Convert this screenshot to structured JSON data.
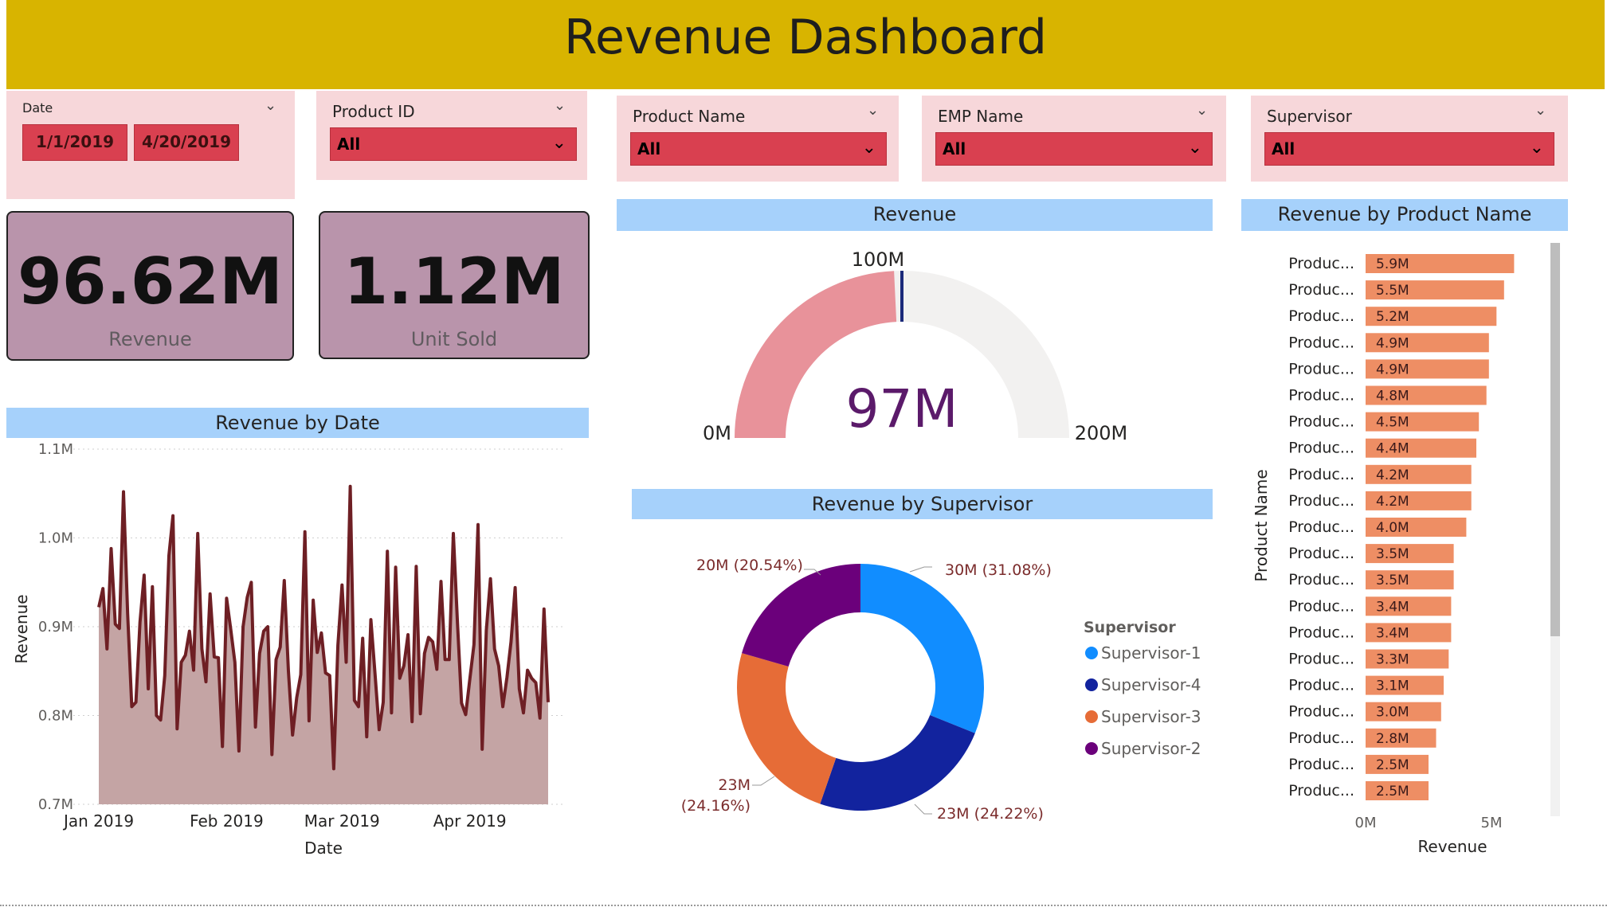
{
  "header": {
    "title": "Revenue Dashboard"
  },
  "filters": {
    "date": {
      "label": "Date",
      "start": "1/1/2019",
      "end": "4/20/2019"
    },
    "product_id": {
      "label": "Product ID",
      "value": "All"
    },
    "product_name": {
      "label": "Product Name",
      "value": "All"
    },
    "emp_name": {
      "label": "EMP Name",
      "value": "All"
    },
    "supervisor": {
      "label": "Supervisor",
      "value": "All"
    }
  },
  "kpis": {
    "revenue": {
      "value": "96.62M",
      "label": "Revenue"
    },
    "units": {
      "value": "1.12M",
      "label": "Unit Sold"
    }
  },
  "colors": {
    "banner": "#d8b400",
    "slicer_bg": "#f7d7da",
    "dropdown": "#d94050",
    "kpi_bg": "#b994ab",
    "title_bar": "#a6d1fb",
    "line": "#6e1f24",
    "area": "#c4a4a4",
    "bars": "#ee8e64",
    "gauge_fill": "#e8929a",
    "gauge_track": "#f2f1f0",
    "gauge_target": "#1b2a7a"
  },
  "chart_data": [
    {
      "type": "area",
      "title": "Revenue by Date",
      "xlabel": "Date",
      "ylabel": "Revenue",
      "ylim": [
        700000,
        1100000
      ],
      "yticks": [
        "0.7M",
        "0.8M",
        "0.9M",
        "1.0M",
        "1.1M"
      ],
      "yticks_values": [
        700000,
        800000,
        900000,
        1000000,
        1100000
      ],
      "xticks": [
        "Jan 2019",
        "Feb 2019",
        "Mar 2019",
        "Apr 2019"
      ],
      "xticks_days": [
        0,
        31,
        59,
        90
      ],
      "x_start": "2019-01-01",
      "series": [
        {
          "values": [
            922000,
            943000,
            875000,
            988000,
            903000,
            898000,
            1052000,
            915000,
            810000,
            815000,
            905000,
            958000,
            830000,
            945000,
            800000,
            795000,
            845000,
            980000,
            1025000,
            785000,
            860000,
            868000,
            895000,
            851000,
            1005000,
            875000,
            838000,
            937000,
            866000,
            865000,
            765000,
            932000,
            897000,
            860000,
            760000,
            900000,
            933000,
            950000,
            787000,
            870000,
            895000,
            900000,
            756000,
            863000,
            877000,
            952000,
            850000,
            778000,
            820000,
            846000,
            1007000,
            794000,
            930000,
            871000,
            893000,
            848000,
            845000,
            740000,
            879000,
            947000,
            860000,
            1058000,
            817000,
            810000,
            887000,
            776000,
            908000,
            847000,
            784000,
            815000,
            985000,
            803000,
            967000,
            842000,
            856000,
            891000,
            793000,
            968000,
            802000,
            870000,
            888000,
            883000,
            852000,
            951000,
            863000,
            863000,
            1005000,
            904000,
            814000,
            801000,
            841000,
            880000,
            1015000,
            762000,
            896000,
            954000,
            875000,
            856000,
            810000,
            843000,
            883000,
            944000,
            830000,
            803000,
            851000,
            842000,
            837000,
            797000,
            920000,
            815000
          ]
        }
      ]
    },
    {
      "type": "gauge",
      "title": "Revenue",
      "value": 97,
      "value_label": "97M",
      "min_label": "0M",
      "max_label": "200M",
      "target_label": "100M",
      "min": 0,
      "max": 200,
      "target": 100
    },
    {
      "type": "pie",
      "title": "Revenue by Supervisor",
      "legend_title": "Supervisor",
      "legend": [
        "Supervisor-1",
        "Supervisor-4",
        "Supervisor-3",
        "Supervisor-2"
      ],
      "slices": [
        {
          "name": "Supervisor-1",
          "value": 31.08,
          "label": "30M (31.08%)",
          "color": "#118dff"
        },
        {
          "name": "Supervisor-4",
          "value": 24.22,
          "label": "23M (24.22%)",
          "color": "#12239e"
        },
        {
          "name": "Supervisor-3",
          "value": 24.16,
          "label_line1": "23M",
          "label_line2": "(24.16%)",
          "color": "#e66c37"
        },
        {
          "name": "Supervisor-2",
          "value": 20.54,
          "label": "20M (20.54%)",
          "color": "#6b007b"
        }
      ]
    },
    {
      "type": "bar",
      "orientation": "horizontal",
      "title": "Revenue by Product Name",
      "xlabel": "Revenue",
      "ylabel": "Product Name",
      "xticks": [
        "0M",
        "5M"
      ],
      "categories": [
        "Produc...",
        "Produc...",
        "Produc...",
        "Produc...",
        "Produc...",
        "Produc...",
        "Produc...",
        "Produc...",
        "Produc...",
        "Produc...",
        "Produc...",
        "Produc...",
        "Produc...",
        "Produc...",
        "Produc...",
        "Produc...",
        "Produc...",
        "Produc...",
        "Produc...",
        "Produc...",
        "Produc..."
      ],
      "values": [
        5.9,
        5.5,
        5.2,
        4.9,
        4.9,
        4.8,
        4.5,
        4.4,
        4.2,
        4.2,
        4.0,
        3.5,
        3.5,
        3.4,
        3.4,
        3.3,
        3.1,
        3.0,
        2.8,
        2.5,
        2.5
      ],
      "labels": [
        "5.9M",
        "5.5M",
        "5.2M",
        "4.9M",
        "4.9M",
        "4.8M",
        "4.5M",
        "4.4M",
        "4.2M",
        "4.2M",
        "4.0M",
        "3.5M",
        "3.5M",
        "3.4M",
        "3.4M",
        "3.3M",
        "3.1M",
        "3.0M",
        "2.8M",
        "2.5M",
        "2.5M"
      ]
    }
  ]
}
